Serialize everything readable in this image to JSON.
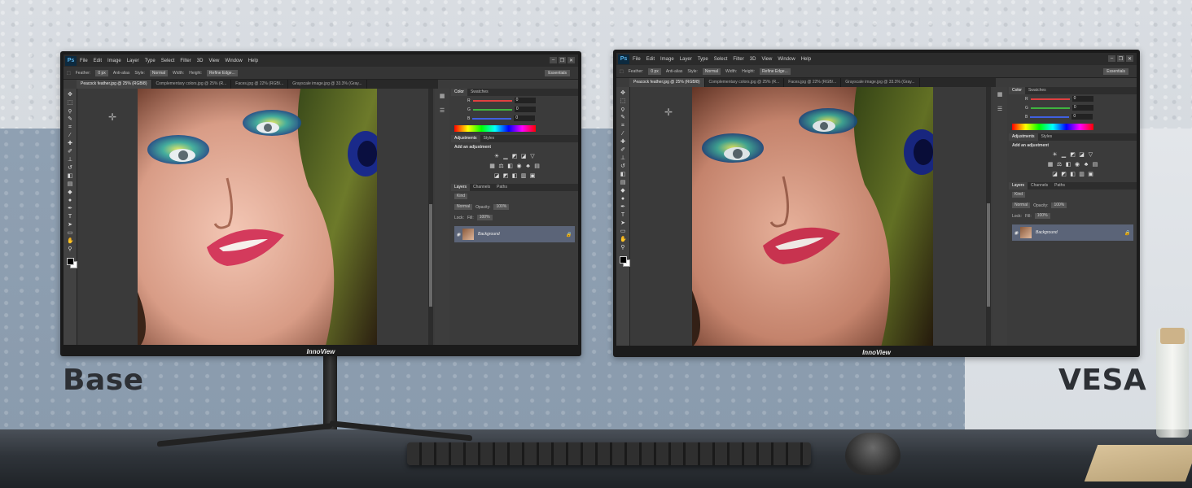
{
  "labels": {
    "left": "Base",
    "right": "VESA"
  },
  "brand": "InnoView",
  "photoshop": {
    "logo": "Ps",
    "menu": [
      "File",
      "Edit",
      "Image",
      "Layer",
      "Type",
      "Select",
      "Filter",
      "3D",
      "View",
      "Window",
      "Help"
    ],
    "window_controls": [
      "minimize-icon",
      "restore-icon",
      "close-icon"
    ],
    "options_bar": {
      "feather_label": "Feather:",
      "feather_value": "0 px",
      "anti_alias": "Anti-alias",
      "style_label": "Style:",
      "style_value": "Normal",
      "width_label": "Width:",
      "height_label": "Height:",
      "refine_edge": "Refine Edge...",
      "workspace": "Essentials"
    },
    "doc_tabs": [
      "Peacock feather.jpg @ 25% (RGB/8)",
      "Complementary colors.jpg @ 25% (R...",
      "Faces.jpg @ 22% (RGB/...",
      "Grayscale image.jpg @ 33.3% (Gray..."
    ],
    "tools": [
      "move-icon",
      "marquee-icon",
      "lasso-icon",
      "quick-select-icon",
      "crop-icon",
      "eyedropper-icon",
      "healing-icon",
      "brush-icon",
      "stamp-icon",
      "history-brush-icon",
      "eraser-icon",
      "gradient-icon",
      "blur-icon",
      "dodge-icon",
      "pen-icon",
      "type-icon",
      "path-select-icon",
      "shape-icon",
      "hand-icon",
      "zoom-icon"
    ],
    "color_panel": {
      "tabs": [
        "Color",
        "Swatches"
      ],
      "channels": [
        {
          "label": "R",
          "value": "0",
          "color": "#e04040"
        },
        {
          "label": "G",
          "value": "0",
          "color": "#3fb43f"
        },
        {
          "label": "B",
          "value": "0",
          "color": "#4060e0"
        }
      ]
    },
    "adjustments_panel": {
      "tabs": [
        "Adjustments",
        "Styles"
      ],
      "title": "Add an adjustment"
    },
    "layers_panel": {
      "tabs": [
        "Layers",
        "Channels",
        "Paths"
      ],
      "kind": "Kind",
      "blend_mode": "Normal",
      "opacity_label": "Opacity:",
      "opacity_value": "100%",
      "lock_label": "Lock:",
      "fill_label": "Fill:",
      "fill_value": "100%",
      "layer_name": "Background"
    }
  }
}
